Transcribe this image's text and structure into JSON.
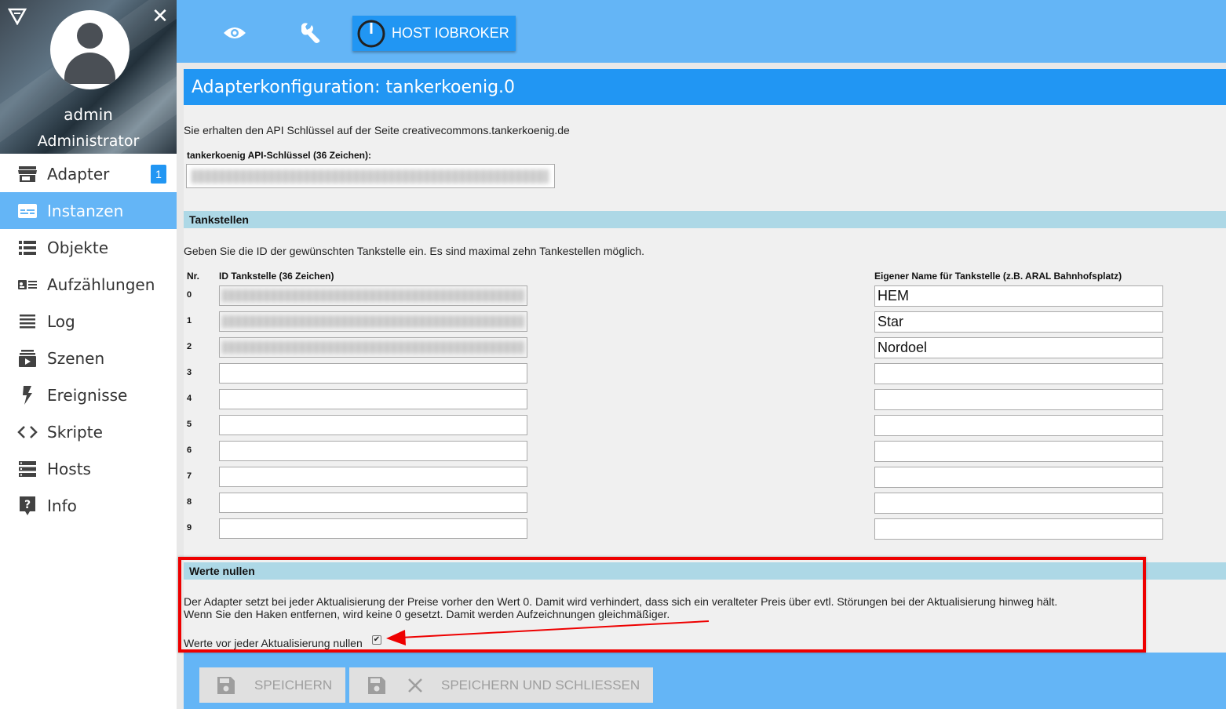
{
  "sidebar": {
    "user": {
      "name": "admin",
      "role": "Administrator"
    },
    "items": [
      {
        "label": "Adapter",
        "icon": "store-icon",
        "badge": "1",
        "active": false
      },
      {
        "label": "Instanzen",
        "icon": "instances-icon",
        "active": true
      },
      {
        "label": "Objekte",
        "icon": "list-icon",
        "active": false
      },
      {
        "label": "Aufzählungen",
        "icon": "enum-icon",
        "active": false
      },
      {
        "label": "Log",
        "icon": "log-icon",
        "active": false
      },
      {
        "label": "Szenen",
        "icon": "scenes-icon",
        "active": false
      },
      {
        "label": "Ereignisse",
        "icon": "flash-icon",
        "active": false
      },
      {
        "label": "Skripte",
        "icon": "code-icon",
        "active": false
      },
      {
        "label": "Hosts",
        "icon": "hosts-icon",
        "active": false
      },
      {
        "label": "Info",
        "icon": "help-icon",
        "active": false
      }
    ]
  },
  "topbar": {
    "host_label": "HOST IOBROKER"
  },
  "main": {
    "title": "Adapterkonfiguration: tankerkoenig.0",
    "api_hint": "Sie erhalten den API Schlüssel auf der Seite creativecommons.tankerkoenig.de",
    "api_label": "tankerkoenig API-Schlüssel (36 Zeichen):",
    "stations_section": "Tankstellen",
    "stations_hint": "Geben Sie die ID der gewünschten Tankstelle ein. Es sind maximal zehn Tankestellen möglich.",
    "columns": {
      "nr": "Nr.",
      "id": "ID Tankstelle (36 Zeichen)",
      "name": "Eigener Name für Tankstelle (z.B. ARAL Bahnhofsplatz)"
    },
    "stations": [
      {
        "nr": "0",
        "name": "HEM",
        "has_id": true
      },
      {
        "nr": "1",
        "name": "Star",
        "has_id": true
      },
      {
        "nr": "2",
        "name": "Nordoel",
        "has_id": true
      },
      {
        "nr": "3",
        "name": "",
        "has_id": false
      },
      {
        "nr": "4",
        "name": "",
        "has_id": false
      },
      {
        "nr": "5",
        "name": "",
        "has_id": false
      },
      {
        "nr": "6",
        "name": "",
        "has_id": false
      },
      {
        "nr": "7",
        "name": "",
        "has_id": false
      },
      {
        "nr": "8",
        "name": "",
        "has_id": false
      },
      {
        "nr": "9",
        "name": "",
        "has_id": false
      }
    ],
    "reset_section": "Werte nullen",
    "reset_text_1": "Der Adapter setzt bei jeder Aktualisierung der Preise vorher den Wert 0. Damit wird verhindert, dass sich ein veralteter Preis über evtl. Störungen bei der Aktualisierung hinweg hält.",
    "reset_text_2": "Wenn Sie den Haken entfernen, wird keine 0 gesetzt. Damit werden Aufzeichnungen gleichmäßiger.",
    "reset_checkbox_label": "Werte vor jeder Aktualisierung nullen",
    "reset_checked": true
  },
  "buttons": {
    "save": "SPEICHERN",
    "save_close": "SPEICHERN UND SCHLIESSEN"
  },
  "colors": {
    "primary": "#2196f3",
    "light": "#64b5f6",
    "section": "#add8e6",
    "highlight": "#e00000"
  }
}
